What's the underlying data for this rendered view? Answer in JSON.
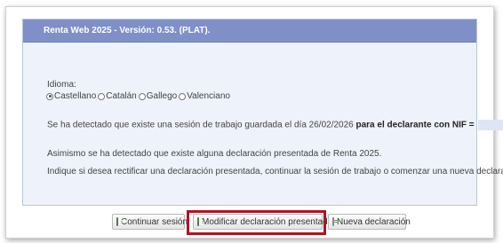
{
  "dialog": {
    "title": "Renta Web 2025 - Versión: 0.53. (PLAT).",
    "idioma_label": "Idioma:",
    "languages": [
      {
        "label": "Castellano",
        "checked": true
      },
      {
        "label": "Catalán",
        "checked": false
      },
      {
        "label": "Gallego",
        "checked": false
      },
      {
        "label": "Valenciano",
        "checked": false
      }
    ],
    "session_text": "Se ha detectado que existe una sesión de trabajo guardada el día 26/02/2026",
    "session_bold": "para el declarante con NIF =",
    "presented_text": "Asimismo se ha detectado que existe alguna declaración presentada de Renta 2025.",
    "instruction_text": "Indique si desea rectificar una declaración presentada, continuar la sesión de trabajo o comenzar una nueva declaración."
  },
  "buttons": {
    "continuar": "Continuar sesión",
    "modificar": "Modificar declaración presentada",
    "nueva": "Nueva declaración"
  },
  "colors": {
    "header": "#7f8fc7",
    "panel": "#eef2fa",
    "highlight": "#b3121e"
  }
}
